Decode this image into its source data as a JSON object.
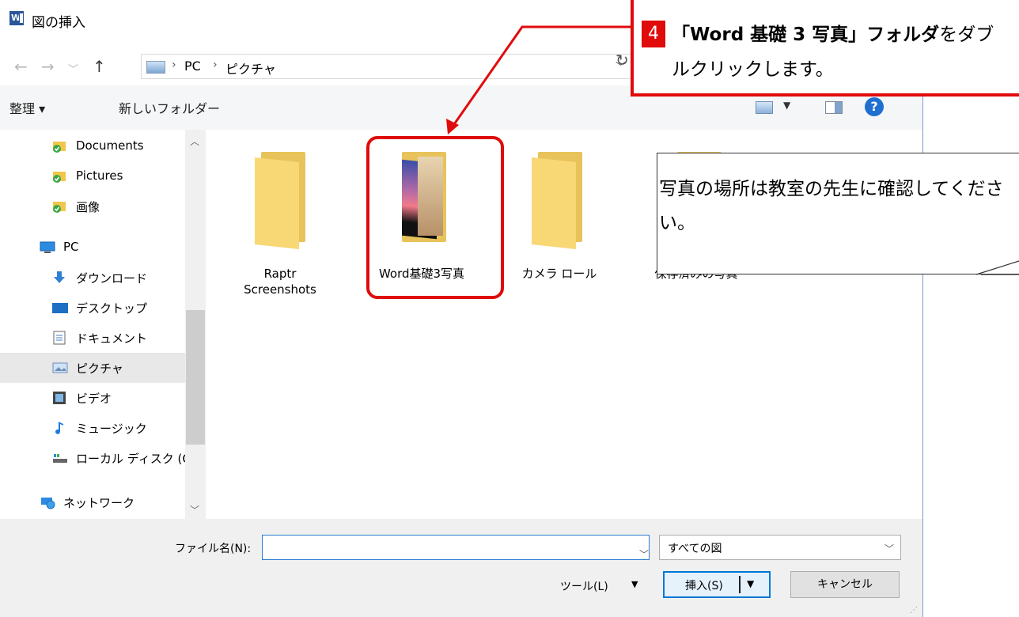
{
  "window": {
    "title": "図の挿入",
    "icon": "word-icon"
  },
  "address": {
    "segments": [
      "PC",
      "ピクチャ"
    ],
    "icons": [
      "back-arrow-icon",
      "forward-arrow-icon",
      "recent-dropdown-icon",
      "up-arrow-icon",
      "pictures-library-icon",
      "refresh-icon"
    ]
  },
  "toolbar": {
    "organize": "整理 ▾",
    "new_folder": "新しいフォルダー"
  },
  "sidebar": {
    "items": [
      {
        "label": "Documents",
        "icon": "onedrive-folder-icon"
      },
      {
        "label": "Pictures",
        "icon": "onedrive-folder-icon"
      },
      {
        "label": "画像",
        "icon": "onedrive-folder-icon"
      },
      {
        "label": "PC",
        "icon": "pc-icon"
      },
      {
        "label": "ダウンロード",
        "icon": "download-icon"
      },
      {
        "label": "デスクトップ",
        "icon": "desktop-icon"
      },
      {
        "label": "ドキュメント",
        "icon": "documents-icon"
      },
      {
        "label": "ピクチャ",
        "icon": "pictures-icon",
        "selected": true
      },
      {
        "label": "ビデオ",
        "icon": "video-icon"
      },
      {
        "label": "ミュージック",
        "icon": "music-icon"
      },
      {
        "label": "ローカル ディスク (C",
        "icon": "drive-icon"
      },
      {
        "label": "ネットワーク",
        "icon": "network-icon"
      }
    ]
  },
  "folders": [
    {
      "label_line1": "Raptr",
      "label_line2": "Screenshots"
    },
    {
      "label_line1": "Word基礎3写真",
      "label_line2": ""
    },
    {
      "label_line1": "カメラ ロール",
      "label_line2": ""
    },
    {
      "label_line1": "保存済みの写真",
      "label_line2": ""
    }
  ],
  "bottom": {
    "filename_label": "ファイル名(N):",
    "filename_value": "",
    "filter_value": "すべての図",
    "tools_label": "ツール(L)",
    "insert_label": "挿入(S)",
    "cancel_label": "キャンセル"
  },
  "callout": {
    "step": "4",
    "bold_text": "「Word 基礎 3 写真」フォルダ",
    "text": "をダブルクリックします。"
  },
  "note": {
    "text": "写真の場所は教室の先生に確認してください。"
  },
  "colors": {
    "accent": "#e00b0b",
    "folder": "#f8d775",
    "selection": "#0078d7"
  }
}
